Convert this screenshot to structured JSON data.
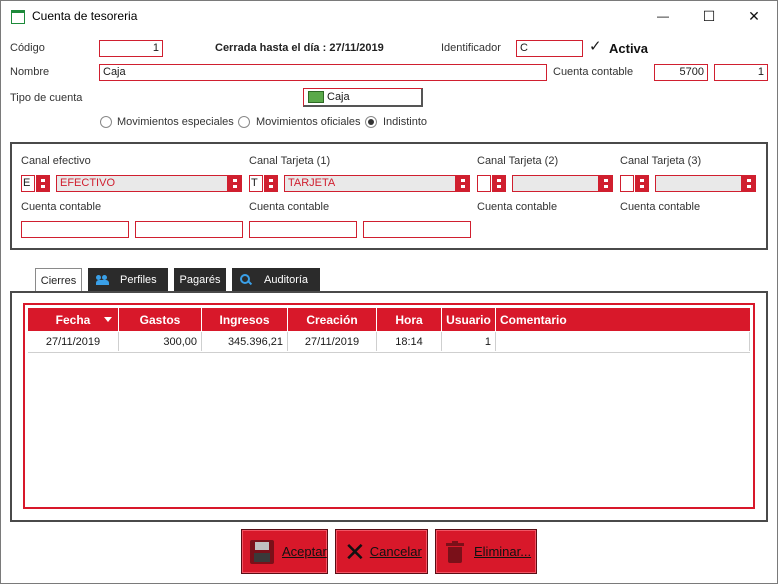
{
  "window": {
    "title": "Cuenta de tesoreria",
    "minimize": "—",
    "maximize": "☐",
    "close": "✕"
  },
  "form": {
    "codigo_label": "Código",
    "codigo_value": "1",
    "cerrada_text": "Cerrada hasta el día : 27/11/2019",
    "identificador_label": "Identificador",
    "identificador_value": "C",
    "activa_label": "Activa",
    "activa_checked": true,
    "nombre_label": "Nombre",
    "nombre_value": "Caja",
    "cuenta_contable_label": "Cuenta contable",
    "cuenta_contable_value1": "5700",
    "cuenta_contable_value2": "1",
    "tipo_label": "Tipo de cuenta",
    "tipo_value": "Caja",
    "radios": [
      {
        "label": "Movimientos especiales",
        "checked": false
      },
      {
        "label": "Movimientos oficiales",
        "checked": false
      },
      {
        "label": "Indistinto",
        "checked": true
      }
    ]
  },
  "canales": {
    "efectivo": {
      "label": "Canal efectivo",
      "code": "E",
      "name": "EFECTIVO",
      "cuenta_label": "Cuenta contable"
    },
    "tarjeta1": {
      "label": "Canal Tarjeta (1)",
      "code": "T",
      "name": "TARJETA",
      "cuenta_label": "Cuenta contable"
    },
    "tarjeta2": {
      "label": "Canal Tarjeta (2)",
      "code": "",
      "name": "",
      "cuenta_label": "Cuenta contable"
    },
    "tarjeta3": {
      "label": "Canal Tarjeta (3)",
      "code": "",
      "name": "",
      "cuenta_label": "Cuenta contable"
    }
  },
  "tabs": [
    {
      "label": "Cierres",
      "active": true,
      "icon": ""
    },
    {
      "label": "Perfiles",
      "active": false,
      "icon": "users-icon"
    },
    {
      "label": "Pagarés",
      "active": false,
      "icon": ""
    },
    {
      "label": "Auditoría",
      "active": false,
      "icon": "search-icon"
    }
  ],
  "grid": {
    "columns": [
      "Fecha",
      "Gastos",
      "Ingresos",
      "Creación",
      "Hora",
      "Usuario",
      "Comentario"
    ],
    "rows": [
      [
        "27/11/2019",
        "300,00",
        "345.396,21",
        "27/11/2019",
        "18:14",
        "1",
        ""
      ]
    ]
  },
  "buttons": {
    "aceptar": "Aceptar",
    "cancelar": "Cancelar",
    "eliminar": "Eliminar..."
  },
  "colors": {
    "accent": "#d8182a",
    "border": "#d01f2f",
    "dark": "#2b2b2b"
  }
}
